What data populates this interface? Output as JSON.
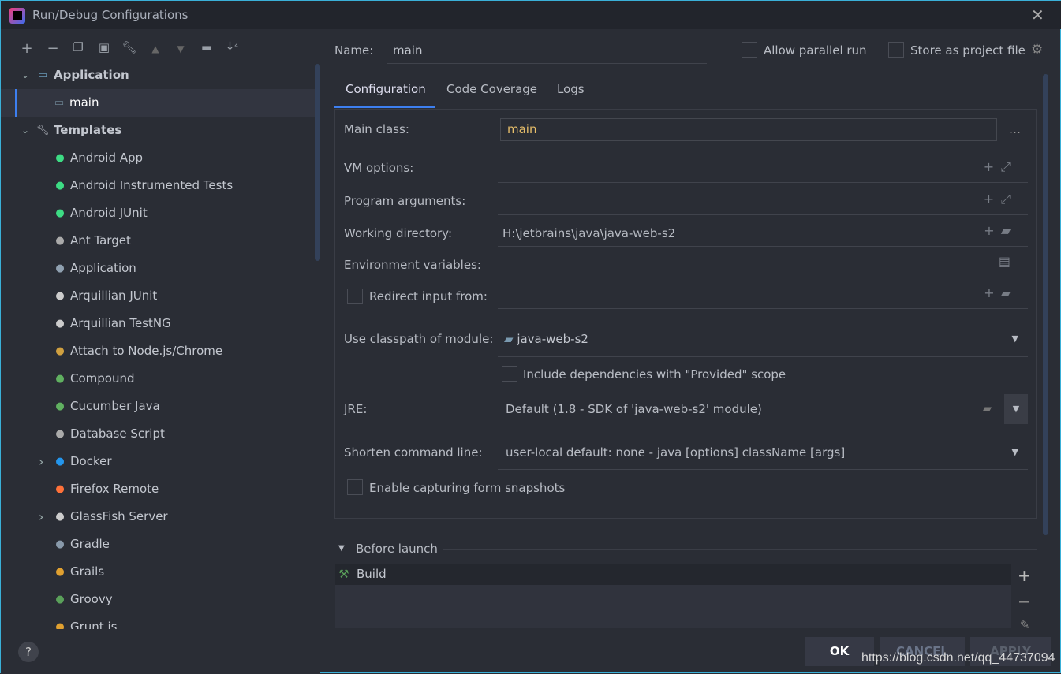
{
  "window": {
    "title": "Run/Debug Configurations"
  },
  "toolbar": [
    "add",
    "remove",
    "copy",
    "save",
    "edit-templates",
    "move-up",
    "move-down",
    "new-folder",
    "sort"
  ],
  "tree": {
    "application_label": "Application",
    "main_label": "main",
    "templates_label": "Templates",
    "templates": [
      {
        "label": "Android App",
        "icon": "android-icon",
        "color": "#3ddc84"
      },
      {
        "label": "Android Instrumented Tests",
        "icon": "android-test-icon",
        "color": "#3ddc84"
      },
      {
        "label": "Android JUnit",
        "icon": "android-junit-icon",
        "color": "#3ddc84"
      },
      {
        "label": "Ant Target",
        "icon": "ant-icon",
        "color": "#aaaaaa"
      },
      {
        "label": "Application",
        "icon": "application-icon",
        "color": "#8fa0b0"
      },
      {
        "label": "Arquillian JUnit",
        "icon": "arquillian-icon",
        "color": "#cccccc"
      },
      {
        "label": "Arquillian TestNG",
        "icon": "arquillian-icon",
        "color": "#cccccc"
      },
      {
        "label": "Attach to Node.js/Chrome",
        "icon": "nodejs-icon",
        "color": "#d0a040"
      },
      {
        "label": "Compound",
        "icon": "compound-icon",
        "color": "#60b060"
      },
      {
        "label": "Cucumber Java",
        "icon": "cucumber-icon",
        "color": "#60b060"
      },
      {
        "label": "Database Script",
        "icon": "database-icon",
        "color": "#aaaaaa"
      },
      {
        "label": "Docker",
        "icon": "docker-icon",
        "color": "#2496ed",
        "expandable": true
      },
      {
        "label": "Firefox Remote",
        "icon": "firefox-icon",
        "color": "#ff7139"
      },
      {
        "label": "GlassFish Server",
        "icon": "glassfish-icon",
        "color": "#cccccc",
        "expandable": true
      },
      {
        "label": "Gradle",
        "icon": "gradle-icon",
        "color": "#8899aa"
      },
      {
        "label": "Grails",
        "icon": "grails-icon",
        "color": "#e0a030"
      },
      {
        "label": "Groovy",
        "icon": "groovy-icon",
        "color": "#5aa05a"
      },
      {
        "label": "Grunt.js",
        "icon": "grunt-icon",
        "color": "#e0a030"
      }
    ]
  },
  "header": {
    "name_label": "Name:",
    "name_value": "main",
    "allow_parallel": "Allow parallel run",
    "store_project": "Store as project file"
  },
  "tabs": [
    "Configuration",
    "Code Coverage",
    "Logs"
  ],
  "form": {
    "main_class_label": "Main class:",
    "main_class": "main",
    "vm_label": "VM options:",
    "args_label": "Program arguments:",
    "wd_label": "Working directory:",
    "wd": "H:\\jetbrains\\java\\java-web-s2",
    "env_label": "Environment variables:",
    "redirect_label": "Redirect input from:",
    "classpath_label": "Use classpath of module:",
    "classpath": "java-web-s2",
    "include_deps": "Include dependencies with \"Provided\" scope",
    "jre_label": "JRE:",
    "jre": "Default (1.8 - SDK of 'java-web-s2' module)",
    "shorten_label": "Shorten command line:",
    "shorten": "user-local default: none - java [options] className [args]",
    "snapshots": "Enable capturing form snapshots"
  },
  "before_launch": {
    "title": "Before launch",
    "items": [
      "Build"
    ]
  },
  "buttons": {
    "ok": "OK",
    "cancel": "CANCEL",
    "apply": "APPLY",
    "help": "?"
  },
  "watermark": "https://blog.csdn.net/qq_44737094",
  "colors": {
    "accent": "#3d7ff0",
    "main_class": "#e8bf6a"
  }
}
